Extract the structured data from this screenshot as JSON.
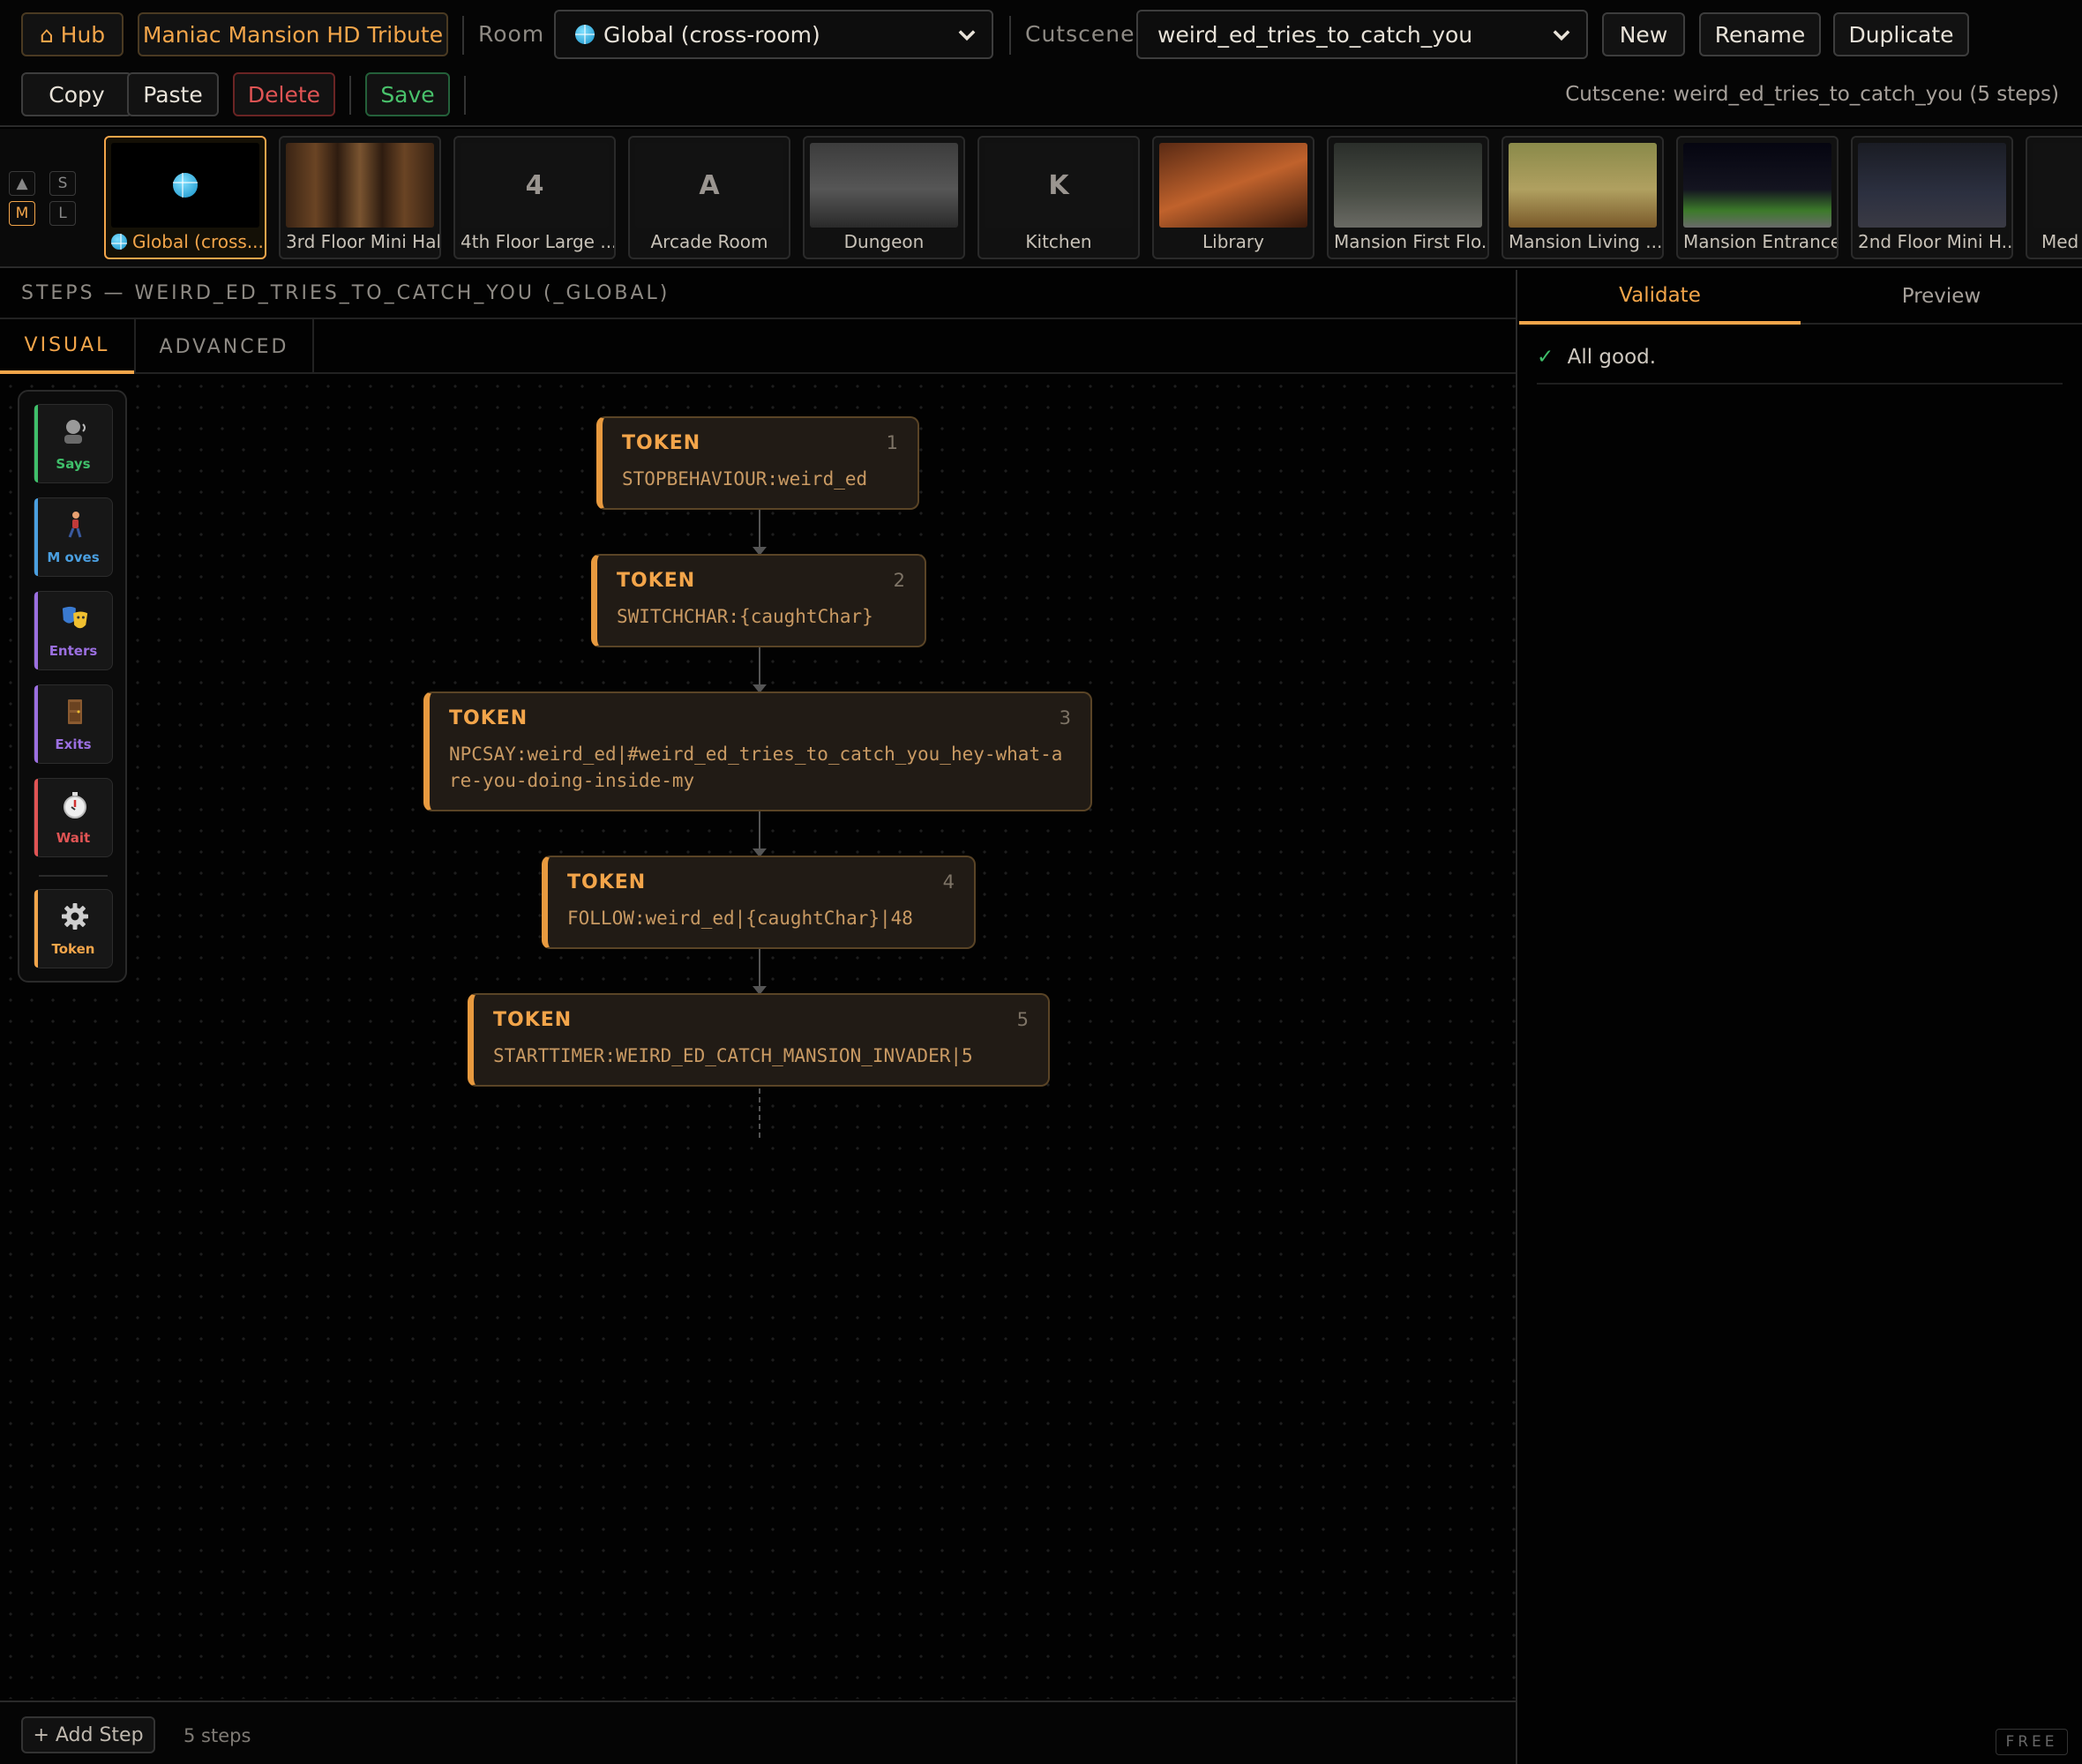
{
  "toolbar": {
    "hub_label": "⌂ Hub",
    "project_label": "Maniac Mansion HD Tribute",
    "room_label": "Room",
    "room_value": "Global (cross-room)",
    "cutscene_label": "Cutscene",
    "cutscene_value": "weird_ed_tries_to_catch_you",
    "new_label": "New",
    "rename_label": "Rename",
    "duplicate_label": "Duplicate",
    "copy_label": "Copy",
    "paste_label": "Paste",
    "delete_label": "Delete",
    "save_label": "Save",
    "status": "Cutscene: weird_ed_tries_to_catch_you (5 steps)"
  },
  "size_toggles": [
    "▲",
    "S",
    "M",
    "L"
  ],
  "rooms": [
    {
      "label": "Global (cross...",
      "letter": "",
      "active": true
    },
    {
      "label": "3rd Floor Mini Hall",
      "letter": ""
    },
    {
      "label": "4th Floor Large ...",
      "letter": "4"
    },
    {
      "label": "Arcade Room",
      "letter": "A"
    },
    {
      "label": "Dungeon",
      "letter": ""
    },
    {
      "label": "Kitchen",
      "letter": "K"
    },
    {
      "label": "Library",
      "letter": ""
    },
    {
      "label": "Mansion First Flo...",
      "letter": ""
    },
    {
      "label": "Mansion Living ...",
      "letter": ""
    },
    {
      "label": "Mansion Entrance",
      "letter": ""
    },
    {
      "label": "2nd Floor Mini H...",
      "letter": ""
    },
    {
      "label": "Med",
      "letter": ""
    }
  ],
  "steps_header": "STEPS — WEIRD_ED_TRIES_TO_CATCH_YOU (_GLOBAL)",
  "tabs": {
    "visual": "VISUAL",
    "advanced": "ADVANCED"
  },
  "palette": [
    {
      "label": "Says",
      "color": "#3fbf6a",
      "icon": "speaking-head-icon"
    },
    {
      "label": "M oves",
      "color": "#4a9fe0",
      "icon": "walking-person-icon"
    },
    {
      "label": "Enters",
      "color": "#9b6fe0",
      "icon": "theater-masks-icon"
    },
    {
      "label": "Exits",
      "color": "#9b6fe0",
      "icon": "door-icon"
    },
    {
      "label": "Wait",
      "color": "#e05454",
      "icon": "stopwatch-icon"
    },
    {
      "label": "Token",
      "color": "#f3a54a",
      "icon": "gear-icon"
    }
  ],
  "steps": [
    {
      "type": "TOKEN",
      "num": "1",
      "code": "STOPBEHAVIOUR:weird_ed"
    },
    {
      "type": "TOKEN",
      "num": "2",
      "code": "SWITCHCHAR:{caughtChar}"
    },
    {
      "type": "TOKEN",
      "num": "3",
      "code": "NPCSAY:weird_ed|#weird_ed_tries_to_catch_you_hey-what-are-you-doing-inside-my"
    },
    {
      "type": "TOKEN",
      "num": "4",
      "code": "FOLLOW:weird_ed|{caughtChar}|48"
    },
    {
      "type": "TOKEN",
      "num": "5",
      "code": "STARTTIMER:WEIRD_ED_CATCH_MANSION_INVADER|5"
    }
  ],
  "footer": {
    "add_step": "+ Add Step",
    "count": "5 steps"
  },
  "right": {
    "validate": "Validate",
    "preview": "Preview",
    "check": "✓",
    "message": "All good.",
    "free": "FREE"
  },
  "colors": {
    "accent": "#f3a54a",
    "danger": "#e05454",
    "success": "#3fbf6a"
  }
}
